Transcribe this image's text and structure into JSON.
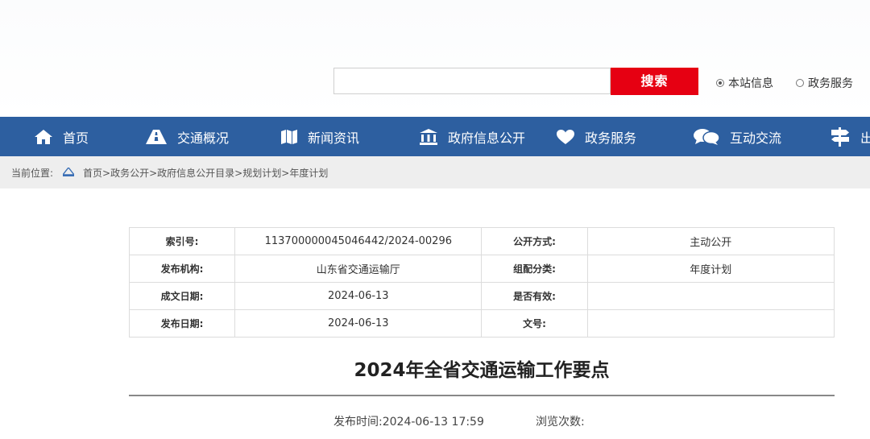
{
  "search": {
    "button_label": "搜索",
    "input_value": "",
    "options": [
      {
        "label": "本站信息",
        "checked": true
      },
      {
        "label": "政务服务",
        "checked": false
      }
    ]
  },
  "nav": {
    "items": [
      {
        "label": "首页",
        "icon": "home-icon"
      },
      {
        "label": "交通概况",
        "icon": "road-icon"
      },
      {
        "label": "新闻资讯",
        "icon": "map-icon"
      },
      {
        "label": "政府信息公开",
        "icon": "building-icon"
      },
      {
        "label": "政务服务",
        "icon": "heart-icon"
      },
      {
        "label": "互动交流",
        "icon": "chat-icon"
      },
      {
        "label": "出",
        "icon": "signpost-icon"
      }
    ]
  },
  "breadcrumb": {
    "prefix": "当前位置:",
    "items": [
      "首页",
      "政务公开",
      "政府信息公开目录",
      "规划计划",
      "年度计划"
    ],
    "separator": ">"
  },
  "meta": {
    "rows": [
      {
        "k1": "索引号:",
        "v1": "113700000045046442/2024-00296",
        "k2": "公开方式:",
        "v2": "主动公开"
      },
      {
        "k1": "发布机构:",
        "v1": "山东省交通运输厅",
        "k2": "组配分类:",
        "v2": "年度计划"
      },
      {
        "k1": "成文日期:",
        "v1": "2024-06-13",
        "k2": "是否有效:",
        "v2": ""
      },
      {
        "k1": "发布日期:",
        "v1": "2024-06-13",
        "k2": "文号:",
        "v2": ""
      }
    ]
  },
  "article": {
    "title": "2024年全省交通运输工作要点",
    "publish_label": "发布时间:",
    "publish_time": "2024-06-13 17:59",
    "views_label": "浏览次数:"
  },
  "colors": {
    "nav_bg": "#2d5fa0",
    "search_button": "#e60012"
  }
}
